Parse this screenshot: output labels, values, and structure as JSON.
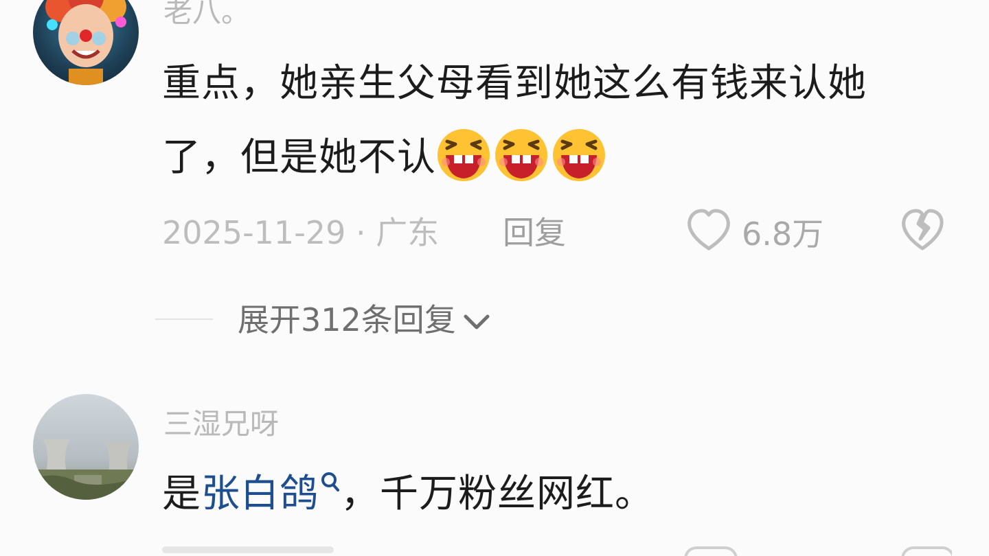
{
  "comments": [
    {
      "username": "老八。",
      "text_line1": "重点，她亲生父母看到她这么有钱来认她",
      "text_line2_prefix": "了，但是她不认",
      "emoji": "laughing-emoji",
      "emoji_count": 3,
      "date": "2025-11-29",
      "location_sep": " · ",
      "location": "广东",
      "reply_label": "回复",
      "likes": "6.8万",
      "expand_label": "展开312条回复"
    },
    {
      "username": "三湿兄呀",
      "text_prefix": "是",
      "mention": "张白鸽",
      "text_suffix": "，千万粉丝网红。"
    }
  ],
  "colors": {
    "background": "#fbfbfb",
    "text": "#1c1c1c",
    "muted": "#bdbdbd",
    "mention": "#1d4e8f",
    "emoji_yellow": "#ffc233"
  },
  "icons": [
    "heart-outline-icon",
    "broken-heart-icon",
    "chevron-down-icon",
    "search-icon"
  ]
}
